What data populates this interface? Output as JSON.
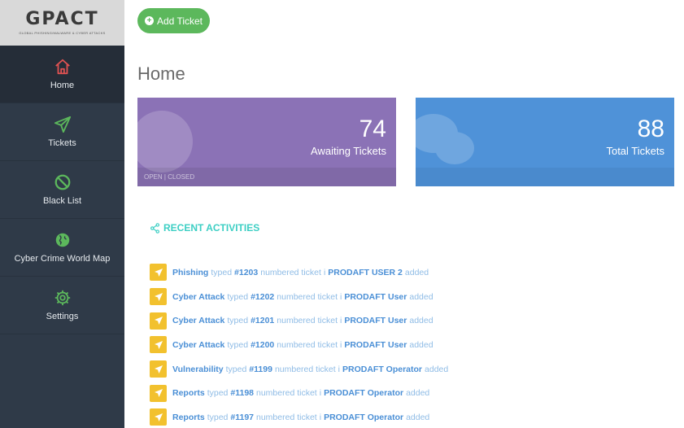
{
  "logo": {
    "text": "GPACT",
    "subtitle": "GLOBAL PHISHING/MALWARE & CYBER ATTACKS"
  },
  "sidebar": {
    "items": [
      {
        "label": "Home",
        "icon": "home-icon",
        "color": "#e05252"
      },
      {
        "label": "Tickets",
        "icon": "paper-plane-icon",
        "color": "#5cb85c"
      },
      {
        "label": "Black List",
        "icon": "ban-icon",
        "color": "#5cb85c"
      },
      {
        "label": "Cyber Crime World Map",
        "icon": "globe-icon",
        "color": "#5cb85c"
      },
      {
        "label": "Settings",
        "icon": "gear-icon",
        "color": "#5cb85c"
      }
    ]
  },
  "toolbar": {
    "add_ticket_label": "Add Ticket"
  },
  "page": {
    "title": "Home"
  },
  "cards": {
    "awaiting": {
      "value": "74",
      "label": "Awaiting Tickets",
      "footer": "OPEN | CLOSED",
      "color": "#8b72b6"
    },
    "total": {
      "value": "88",
      "label": "Total Tickets",
      "color": "#4f92d8"
    }
  },
  "recent": {
    "title": "RECENT ACTIVITIES",
    "items": [
      {
        "type": "Phishing",
        "typed": "typed",
        "ticket": "#1203",
        "mid": "numbered ticket",
        "sep": "i",
        "user": "PRODAFT USER 2",
        "action": "added"
      },
      {
        "type": "Cyber Attack",
        "typed": "typed",
        "ticket": "#1202",
        "mid": "numbered ticket",
        "sep": "i",
        "user": "PRODAFT User",
        "action": "added"
      },
      {
        "type": "Cyber Attack",
        "typed": "typed",
        "ticket": "#1201",
        "mid": "numbered ticket",
        "sep": "i",
        "user": "PRODAFT User",
        "action": "added"
      },
      {
        "type": "Cyber Attack",
        "typed": "typed",
        "ticket": "#1200",
        "mid": "numbered ticket",
        "sep": "i",
        "user": "PRODAFT User",
        "action": "added"
      },
      {
        "type": "Vulnerability",
        "typed": "typed",
        "ticket": "#1199",
        "mid": "numbered ticket",
        "sep": "i",
        "user": "PRODAFT Operator",
        "action": "added"
      },
      {
        "type": "Reports",
        "typed": "typed",
        "ticket": "#1198",
        "mid": "numbered ticket",
        "sep": "i",
        "user": "PRODAFT Operator",
        "action": "added"
      },
      {
        "type": "Reports",
        "typed": "typed",
        "ticket": "#1197",
        "mid": "numbered ticket",
        "sep": "i",
        "user": "PRODAFT Operator",
        "action": "added"
      }
    ]
  }
}
